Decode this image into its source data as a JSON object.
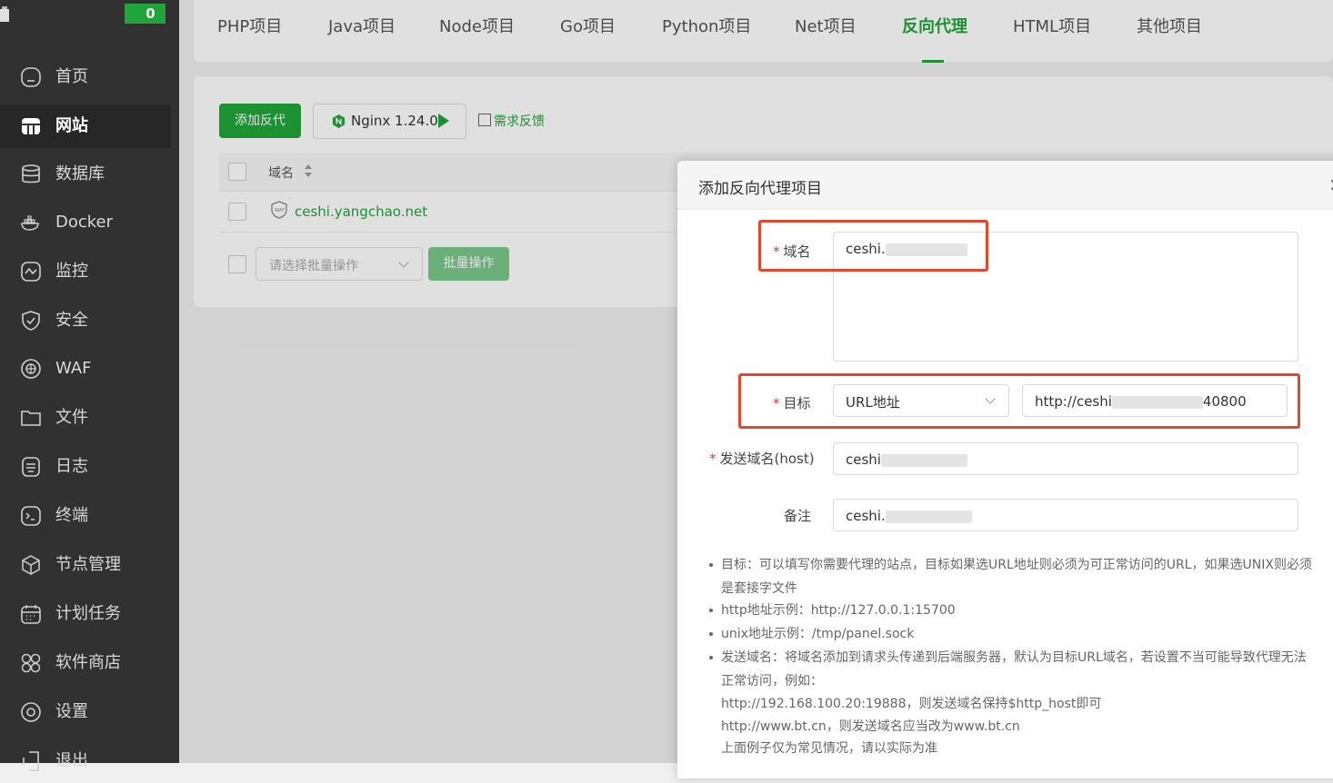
{
  "sidebar": {
    "badge_count": "0",
    "items": [
      {
        "label": "首页",
        "icon": "home-icon"
      },
      {
        "label": "网站",
        "icon": "website-icon"
      },
      {
        "label": "数据库",
        "icon": "database-icon"
      },
      {
        "label": "Docker",
        "icon": "docker-icon"
      },
      {
        "label": "监控",
        "icon": "monitor-icon"
      },
      {
        "label": "安全",
        "icon": "shield-icon"
      },
      {
        "label": "WAF",
        "icon": "waf-icon"
      },
      {
        "label": "文件",
        "icon": "folder-icon"
      },
      {
        "label": "日志",
        "icon": "log-icon"
      },
      {
        "label": "终端",
        "icon": "terminal-icon"
      },
      {
        "label": "节点管理",
        "icon": "node-icon"
      },
      {
        "label": "计划任务",
        "icon": "calendar-icon"
      },
      {
        "label": "软件商店",
        "icon": "apps-icon"
      },
      {
        "label": "设置",
        "icon": "settings-icon"
      },
      {
        "label": "退出",
        "icon": "logout-icon"
      }
    ]
  },
  "tabs": [
    {
      "label": "PHP项目"
    },
    {
      "label": "Java项目"
    },
    {
      "label": "Node项目"
    },
    {
      "label": "Go项目"
    },
    {
      "label": "Python项目"
    },
    {
      "label": "Net项目"
    },
    {
      "label": "反向代理"
    },
    {
      "label": "HTML项目"
    },
    {
      "label": "其他项目"
    }
  ],
  "toolbar": {
    "add_label": "添加反代",
    "nginx_label": "Nginx 1.24.0",
    "feedback_label": "需求反馈"
  },
  "table": {
    "col_domain": "域名",
    "rows": [
      {
        "domain": "ceshi.yangchao.net"
      }
    ],
    "batch_placeholder": "请选择批量操作",
    "batch_button": "批量操作"
  },
  "dialog": {
    "title": "添加反向代理项目",
    "close": "×",
    "domain_label": "域名",
    "domain_value": "ceshi.",
    "target_label": "目标",
    "target_type": "URL地址",
    "target_value_start": "http://ceshi",
    "target_value_end": "40800",
    "host_label": "发送域名(host)",
    "host_value": "ceshi",
    "remark_label": "备注",
    "remark_value": "ceshi.",
    "help": [
      "目标：可以填写你需要代理的站点，目标如果选URL地址则必须为可正常访问的URL，如果选UNIX则必须",
      "是套接字文件",
      "http地址示例：http://127.0.0.1:15700",
      "unix地址示例：/tmp/panel.sock",
      "发送域名：将域名添加到请求头传递到后端服务器，默认为目标URL域名，若设置不当可能导致代理无法",
      "正常访问，例如：",
      "http://192.168.100.20:19888，则发送域名保持$http_host即可",
      "http://www.bt.cn，则发送域名应当改为www.bt.cn",
      "上面例子仅为常见情况，请以实际为准"
    ]
  },
  "colors": {
    "accent": "#20a53a",
    "highlight_box": "#e5462c",
    "sidebar_bg": "#313131"
  }
}
